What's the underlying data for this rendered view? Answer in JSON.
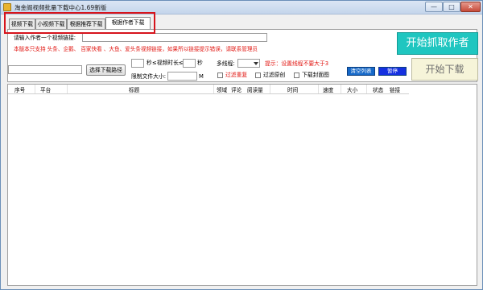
{
  "window": {
    "title": "淘金阁视频批量下载中心1.69新版",
    "min_label": "—",
    "max_label": "□",
    "close_label": "✕"
  },
  "tabs": [
    {
      "label": "视频下载"
    },
    {
      "label": "小视频下载"
    },
    {
      "label": "根据推荐下载"
    },
    {
      "label": "根据作者下载"
    }
  ],
  "author": {
    "link_label": "请输入作者一个视频链接:",
    "link_value": "",
    "notice": "本版本只支持 头条、企鹅、 百家快看 、大鱼、爱头条视频链接，如果所以链接提示错误，请联系管理员",
    "grab_button": "开始抓取作者"
  },
  "options": {
    "path_value": "",
    "path_button": "选择下载路径",
    "duration_min": "",
    "duration_unit_1": "秒",
    "duration_mid": "≤视频时长≤",
    "duration_max": "",
    "duration_unit_2": "秒",
    "size_label": "限制文件大小:",
    "size_value": "",
    "size_unit": "M",
    "threads_label": "多线程:",
    "threads_value": "",
    "threads_hint": "提示：设置线程不要大于3",
    "filter_dup": "过滤重复",
    "filter_original": "过滤原创",
    "download_cover": "下载封面图",
    "clear_button": "清空列表",
    "pause_button": "暂停",
    "start_button": "开始下载"
  },
  "list": {
    "columns": [
      "序号",
      "平台",
      "标题",
      "领域",
      "评论",
      "阅读量",
      "时间",
      "速度",
      "大小",
      "状态",
      "链接"
    ]
  }
}
